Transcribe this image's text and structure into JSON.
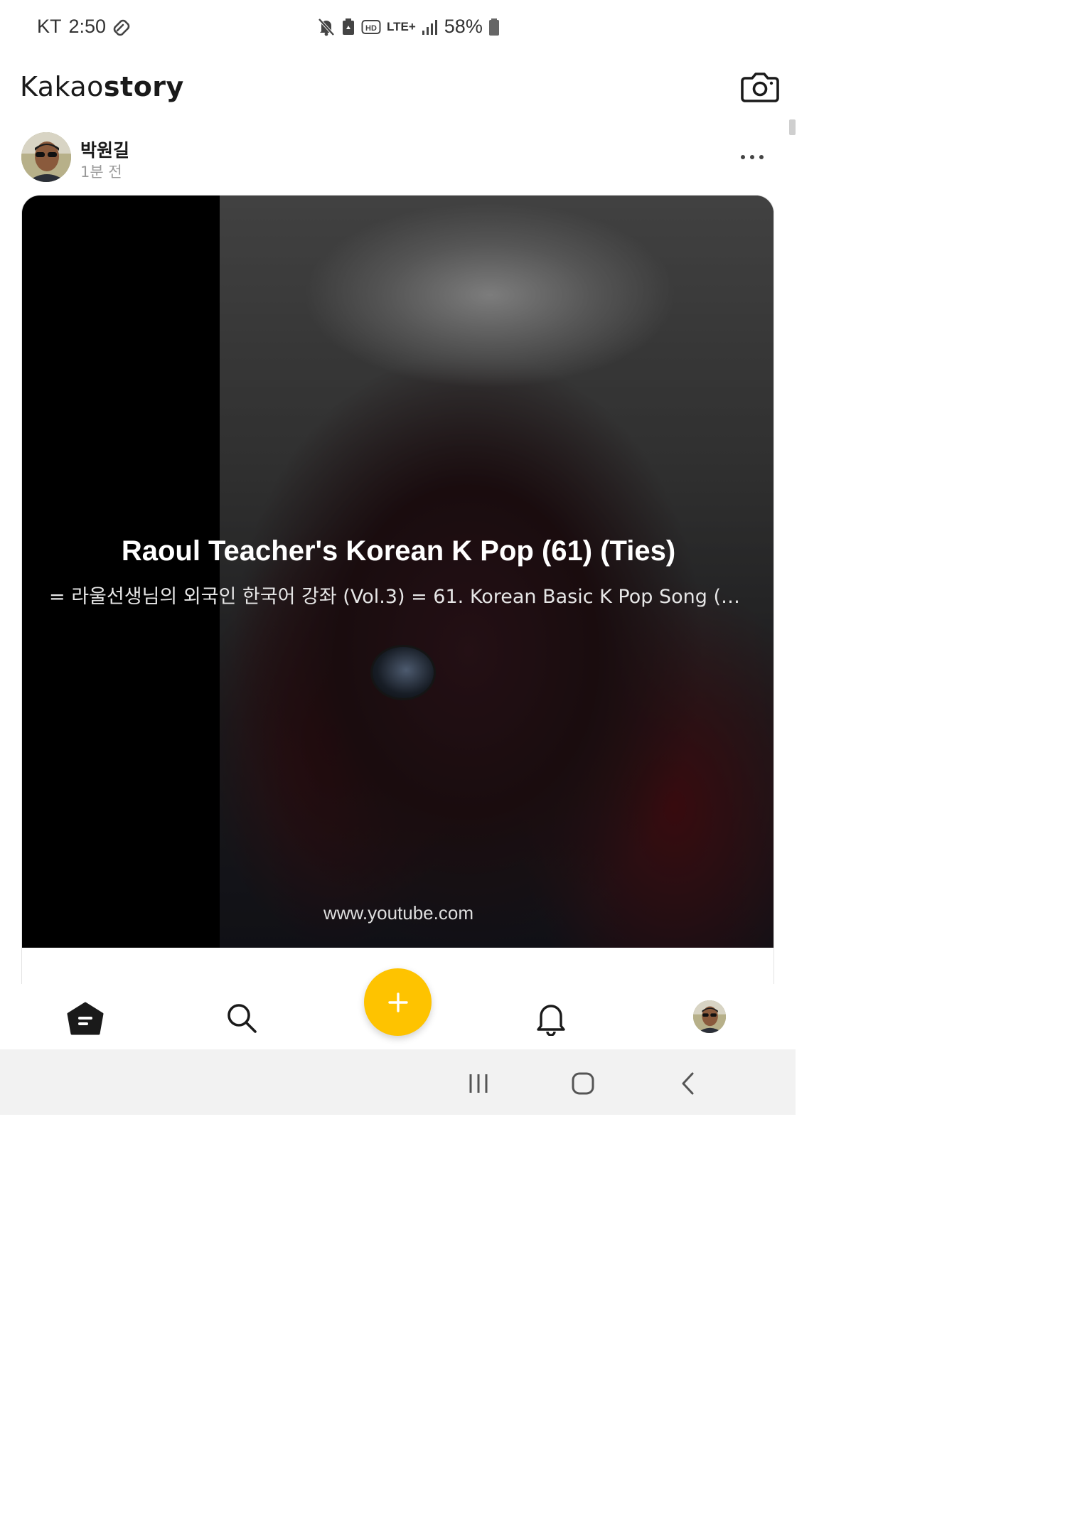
{
  "status_bar": {
    "carrier": "KT",
    "time": "2:50",
    "network": "LTE+",
    "hd_badge": "HD",
    "battery": "58%"
  },
  "header": {
    "brand_light": "Kakao",
    "brand_bold": "story",
    "camera_icon": "camera-icon"
  },
  "post": {
    "author": "박원길",
    "time_ago": "1분 전",
    "link_preview": {
      "title": "Raoul Teacher's Korean K Pop (61) (Ties)",
      "description": "= 라울선생님의 외국인 한국어 강좌 (Vol.3) =  61. Korean Basic K Pop Song (인…",
      "source": "www.youtube.com"
    }
  },
  "bottom_nav": {
    "items": [
      "home-icon",
      "search-icon",
      "add-icon",
      "bell-icon",
      "profile-avatar"
    ],
    "fab_color": "#fec300"
  },
  "system_nav": [
    "recents-icon",
    "home-button-icon",
    "back-icon"
  ]
}
